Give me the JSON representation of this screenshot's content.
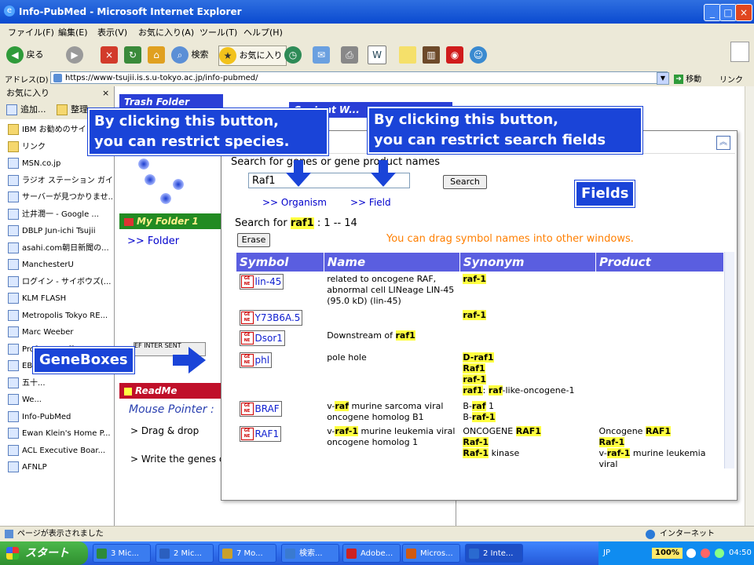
{
  "window": {
    "title": "Info-PubMed - Microsoft Internet Explorer"
  },
  "menu": [
    "ファイル(F)",
    "編集(E)",
    "表示(V)",
    "お気に入り(A)",
    "ツール(T)",
    "ヘルプ(H)"
  ],
  "toolbar": {
    "back": "戻る",
    "search": "検索",
    "favorites": "お気に入り"
  },
  "address": {
    "label": "アドレス(D)",
    "url": "https://www-tsujii.is.s.u-tokyo.ac.jp/info-pubmed/",
    "go": "移動",
    "links": "リンク"
  },
  "favorites": {
    "header": "お気に入り",
    "add": "追加...",
    "organize": "整理",
    "items": [
      "IBM お勧めのサイト",
      "リンク",
      "MSN.co.jp",
      "ラジオ ステーション ガイ...",
      "サーバーが見つかりませ...",
      "辻井潤一 - Google ...",
      "DBLP Jun-ichi Tsujii",
      "asahi.com朝日新聞の...",
      "ManchesterU",
      "ログイン - サイボウズ(...",
      "KLM FLASH",
      "Metropolis Tokyo RE...",
      "Marc Weeber",
      "Prof. Dr. Steffen Staa...",
      "EBI Research and Se...",
      "五十...",
      "We...",
      "Info-PubMed",
      "Ewan Klein's Home P...",
      "ACL Executive Boar...",
      "AFNLP"
    ]
  },
  "bg": {
    "trash": "Trash Folder",
    "content": "Content W...",
    "my_folder": "My Folder 1",
    "folder_link": ">> Folder",
    "readme": "ReadMe Windo...",
    "mouse_pointer": "Mouse Pointer :",
    "drag_drop": "> Drag & drop",
    "write": "> Write the genes c"
  },
  "popup": {
    "search_label": "Search for genes or gene product names",
    "query": "Raf1",
    "search_button": "Search",
    "organism_link": ">> Organism",
    "field_link": ">> Field",
    "results_prefix": "Search for",
    "results_term": "raf1",
    "results_range": ": 1 -- 14",
    "erase": "Erase",
    "drag_hint": "You can drag symbol names into other windows.",
    "columns": [
      "Symbol",
      "Name",
      "Synonym",
      "Product"
    ],
    "rows": [
      {
        "symbol": "lin-45",
        "name": "related to oncogene RAF, abnormal cell LINeage LIN-45 (95.0 kD) (lin-45)",
        "synonym": [
          "raf-1"
        ],
        "product": []
      },
      {
        "symbol": "Y73B6A.5",
        "name": "",
        "synonym": [
          "raf-1"
        ],
        "product": []
      },
      {
        "symbol": "Dsor1",
        "name": "Downstream of raf1",
        "synonym": [],
        "product": []
      },
      {
        "symbol": "phl",
        "name": "pole hole",
        "synonym": [
          "D-raf1",
          "Raf1",
          "raf-1",
          "raf1: raf-like-oncogene-1"
        ],
        "product": []
      },
      {
        "symbol": "BRAF",
        "name": "v-raf murine sarcoma viral oncogene homolog B1",
        "synonym": [
          "B-raf 1",
          "B-raf-1"
        ],
        "product": []
      },
      {
        "symbol": "RAF1",
        "name": "v-raf-1 murine leukemia viral oncogene homolog 1",
        "synonym": [
          "ONCOGENE RAF1",
          "Raf-1",
          "Raf-1 kinase"
        ],
        "product": [
          "Oncogene RAF1",
          "Raf-1",
          "v-raf-1 murine leukemia viral"
        ]
      }
    ]
  },
  "callouts": {
    "species": "By clicking this button,\nyou can restrict species.",
    "fields_restrict": "By clicking this button,\nyou can restrict search fields",
    "fields": "Fields",
    "geneboxes": "GeneBoxes"
  },
  "status": {
    "text": "ページが表示されました",
    "zone": "インターネット"
  },
  "taskbar": {
    "start": "スタート",
    "tasks": [
      "3 Mic...",
      "2 Mic...",
      "7 Mo...",
      "検索...",
      "Adobe...",
      "Micros...",
      "2 Inte..."
    ],
    "lang": "JP",
    "zoom": "100%",
    "clock": "04:50"
  },
  "colors": {
    "accent": "#1a44d8",
    "table_header": "#5a5ee0",
    "highlight": "#ffff40",
    "drag_hint": "#ff7f00"
  }
}
